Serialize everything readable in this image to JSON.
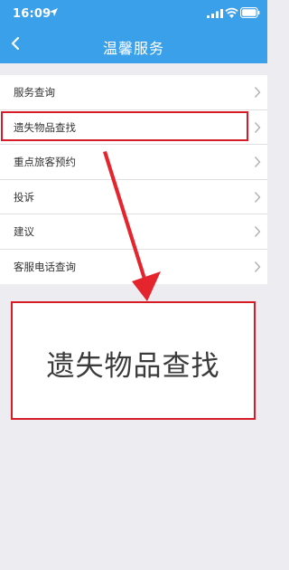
{
  "status_bar": {
    "time": "16:09",
    "location_icon": "location-arrow-icon",
    "signal_icon": "cellular-signal-icon",
    "wifi_icon": "wifi-icon",
    "battery_icon": "battery-icon"
  },
  "nav": {
    "title": "温馨服务",
    "back_icon": "chevron-left-icon"
  },
  "menu": {
    "items": [
      {
        "label": "服务查询"
      },
      {
        "label": "遗失物品查找"
      },
      {
        "label": "重点旅客预约"
      },
      {
        "label": "投诉"
      },
      {
        "label": "建议"
      },
      {
        "label": "客服电话查询"
      }
    ],
    "chevron_icon": "chevron-right-icon"
  },
  "annotation": {
    "zoom_label": "遗失物品查找",
    "arrow_icon": "red-arrow-icon"
  },
  "colors": {
    "header": "#3aa0ea",
    "background": "#ececf1",
    "highlight": "#d81c27"
  }
}
